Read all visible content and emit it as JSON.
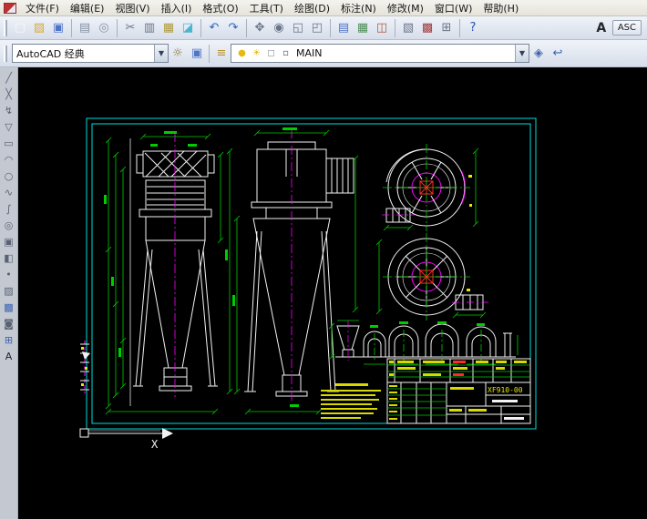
{
  "menu": {
    "items": [
      {
        "name": "menu-file",
        "label": "文件(F)"
      },
      {
        "name": "menu-edit",
        "label": "编辑(E)"
      },
      {
        "name": "menu-view",
        "label": "视图(V)"
      },
      {
        "name": "menu-insert",
        "label": "插入(I)"
      },
      {
        "name": "menu-format",
        "label": "格式(O)"
      },
      {
        "name": "menu-tools",
        "label": "工具(T)"
      },
      {
        "name": "menu-draw",
        "label": "绘图(D)"
      },
      {
        "name": "menu-dimension",
        "label": "标注(N)"
      },
      {
        "name": "menu-modify",
        "label": "修改(M)"
      },
      {
        "name": "menu-window",
        "label": "窗口(W)"
      },
      {
        "name": "menu-help",
        "label": "帮助(H)"
      }
    ]
  },
  "toolbar_standard": {
    "icons": [
      {
        "name": "qnew-icon",
        "glyph": "▢",
        "color": "#f8f8f8"
      },
      {
        "name": "open-icon",
        "glyph": "▨",
        "color": "#d8a93a"
      },
      {
        "name": "save-icon",
        "glyph": "▣",
        "color": "#4f74c8"
      },
      {
        "type": "sep"
      },
      {
        "name": "plot-icon",
        "glyph": "▤",
        "color": "#8893a5"
      },
      {
        "name": "plot-preview-icon",
        "glyph": "◎",
        "color": "#8893a5"
      },
      {
        "type": "sep"
      },
      {
        "name": "cut-icon",
        "glyph": "✂",
        "color": "#6a7488"
      },
      {
        "name": "copy-icon",
        "glyph": "▥",
        "color": "#6a7488"
      },
      {
        "name": "paste-icon",
        "glyph": "▦",
        "color": "#b09a40"
      },
      {
        "name": "match-properties-icon",
        "glyph": "◪",
        "color": "#49b6d2"
      },
      {
        "type": "sep"
      },
      {
        "name": "undo-icon",
        "glyph": "↶",
        "color": "#2f62c4"
      },
      {
        "name": "redo-icon",
        "glyph": "↷",
        "color": "#2f62c4"
      },
      {
        "type": "sep"
      },
      {
        "name": "pan-icon",
        "glyph": "✥",
        "color": "#6a7488"
      },
      {
        "name": "zoom-realtime-icon",
        "glyph": "◉",
        "color": "#6a7488"
      },
      {
        "name": "zoom-window-icon",
        "glyph": "◱",
        "color": "#6a7488"
      },
      {
        "name": "zoom-previous-icon",
        "glyph": "◰",
        "color": "#6a7488"
      },
      {
        "type": "sep"
      },
      {
        "name": "properties-icon",
        "glyph": "▤",
        "color": "#4f74c8"
      },
      {
        "name": "design-center-icon",
        "glyph": "▦",
        "color": "#4f8f57"
      },
      {
        "name": "tool-palettes-icon",
        "glyph": "◫",
        "color": "#b3563e"
      },
      {
        "type": "sep"
      },
      {
        "name": "sheet-set-manager-icon",
        "glyph": "▧",
        "color": "#6a7488"
      },
      {
        "name": "markup-set-manager-icon",
        "glyph": "▩",
        "color": "#a03a3a"
      },
      {
        "name": "quickcalc-icon",
        "glyph": "⊞",
        "color": "#6a7488"
      },
      {
        "type": "sep"
      },
      {
        "name": "help-icon",
        "glyph": "?",
        "color": "#2a52b8"
      }
    ],
    "text_style_label": "A",
    "asc_label": "ASC"
  },
  "toolbar_layers": {
    "workspace_value": "AutoCAD 经典",
    "dropdown_glyph": "▼",
    "left_icons": [
      {
        "name": "workspace-settings-icon",
        "glyph": "☼",
        "color": "#8a6d2f"
      },
      {
        "name": "workspace-save-icon",
        "glyph": "▣",
        "color": "#4f74c8"
      }
    ],
    "layer_tool_icons": [
      {
        "name": "layer-properties-manager-icon",
        "glyph": "≡",
        "color": "#b8912f"
      }
    ],
    "layer_state_icons": [
      {
        "name": "layer-on-bulb-icon",
        "glyph": "●",
        "color": "#e8b90f"
      },
      {
        "name": "layer-thaw-sun-icon",
        "glyph": "☀",
        "color": "#e8b90f"
      },
      {
        "name": "layer-lock-icon",
        "glyph": "◻",
        "color": "#8a93a3"
      },
      {
        "name": "layer-color-icon",
        "glyph": "▫",
        "color": "#555c68"
      }
    ],
    "layer_value": "MAIN",
    "right_icons": [
      {
        "name": "make-object-layer-current-icon",
        "glyph": "◈",
        "color": "#3e64b0"
      },
      {
        "name": "layer-previous-icon",
        "glyph": "↩",
        "color": "#3e64b0"
      }
    ]
  },
  "draw_toolbar": {
    "icons": [
      {
        "name": "line-icon",
        "glyph": "╱",
        "color": "#5a6374"
      },
      {
        "name": "construction-line-icon",
        "glyph": "╳",
        "color": "#5a6374"
      },
      {
        "name": "polyline-icon",
        "glyph": "↯",
        "color": "#5a6374"
      },
      {
        "name": "polygon-icon",
        "glyph": "▽",
        "color": "#5a6374"
      },
      {
        "name": "rectangle-icon",
        "glyph": "▭",
        "color": "#5a6374"
      },
      {
        "name": "arc-icon",
        "glyph": "◠",
        "color": "#5a6374"
      },
      {
        "name": "circle-icon",
        "glyph": "○",
        "color": "#5a6374"
      },
      {
        "name": "revision-cloud-icon",
        "glyph": "∿",
        "color": "#5a6374"
      },
      {
        "name": "spline-icon",
        "glyph": "∫",
        "color": "#5a6374"
      },
      {
        "name": "ellipse-icon",
        "glyph": "◎",
        "color": "#5a6374"
      },
      {
        "name": "insert-block-icon",
        "glyph": "▣",
        "color": "#5a6374"
      },
      {
        "name": "make-block-icon",
        "glyph": "◧",
        "color": "#5a6374"
      },
      {
        "name": "point-icon",
        "glyph": "•",
        "color": "#5a6374"
      },
      {
        "name": "hatch-icon",
        "glyph": "▨",
        "color": "#5a6374"
      },
      {
        "name": "gradient-icon",
        "glyph": "▩",
        "color": "#3e64b0"
      },
      {
        "name": "region-icon",
        "glyph": "◙",
        "color": "#5a6374"
      },
      {
        "name": "table-icon",
        "glyph": "⊞",
        "color": "#3e64b0"
      },
      {
        "name": "multiline-text-icon",
        "glyph": "A",
        "color": "#23262c"
      }
    ]
  },
  "canvas": {
    "ucs_x_label": "X",
    "title_block": {
      "drawing_number": "XF910-00"
    }
  }
}
